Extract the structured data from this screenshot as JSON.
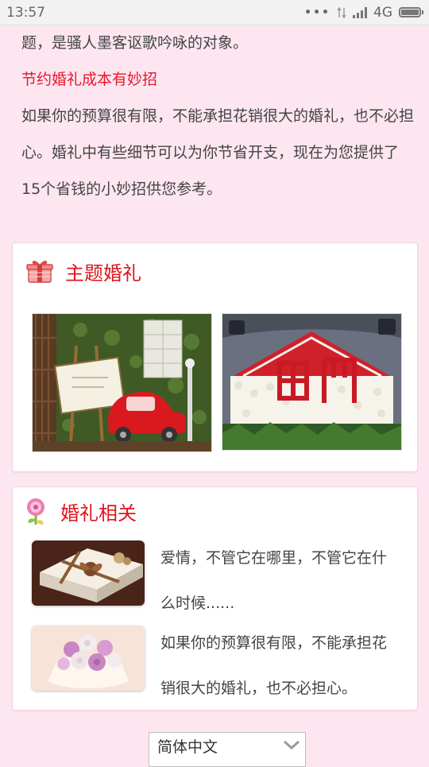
{
  "status_bar": {
    "time": "13:57",
    "dots": "•••",
    "network": "4G"
  },
  "intro": {
    "line1": "题，是骚人墨客讴歌吟咏的对象。",
    "red_title": "节约婚礼成本有妙招",
    "paragraph": "如果你的预算很有限，不能承担花销很大的婚礼，也不必担心。婚礼中有些细节可以为你节省开支，现在为您提供了15个省钱的小妙招供您参考。"
  },
  "theme_section": {
    "icon": "gift-icon",
    "title": "主题婚礼",
    "images": [
      "wedding-car-decoration-photo",
      "rose-car-decoration-photo"
    ]
  },
  "related_section": {
    "icon": "lollipop-flower-icon",
    "title": "婚礼相关",
    "items": [
      {
        "thumb": "gift-box-photo",
        "text": "爱情，不管它在哪里，不管它在什么时候......"
      },
      {
        "thumb": "bridal-bouquet-photo",
        "text": "如果你的预算很有限，不能承担花销很大的婚礼，也不必担心。"
      }
    ]
  },
  "language_select": {
    "selected": "简体中文",
    "icon": "chevron-down-icon"
  },
  "colors": {
    "page_bg": "#fde6f0",
    "accent_red": "#e0141c"
  }
}
